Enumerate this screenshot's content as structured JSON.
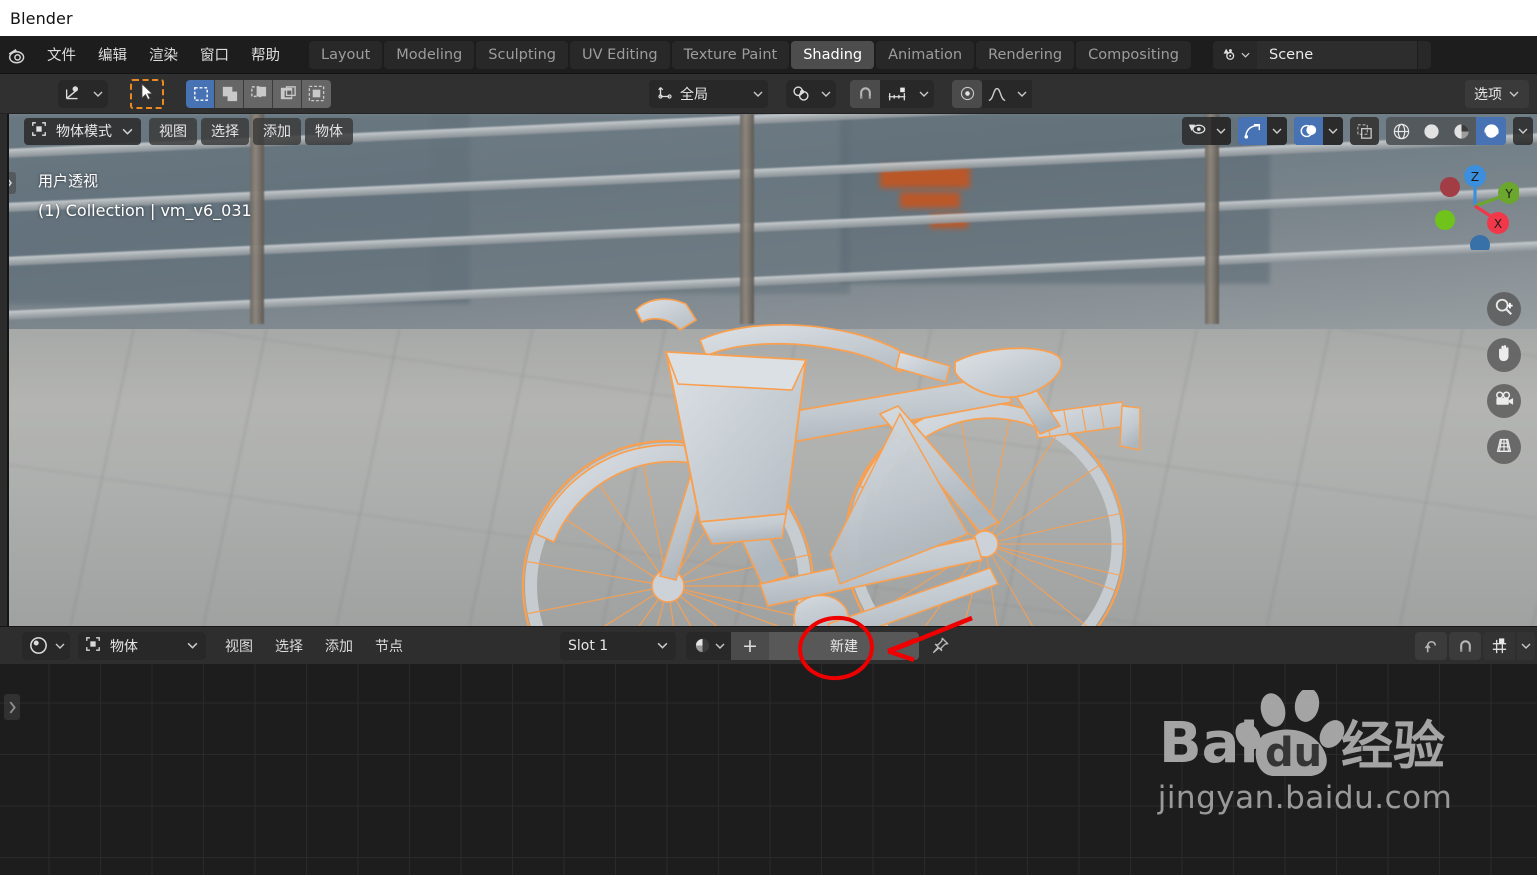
{
  "window": {
    "title": "Blender"
  },
  "topbar": {
    "logo_icon": "blender-logo-icon",
    "menus": [
      {
        "label": "文件",
        "name": "menu-file"
      },
      {
        "label": "编辑",
        "name": "menu-edit"
      },
      {
        "label": "渲染",
        "name": "menu-render"
      },
      {
        "label": "窗口",
        "name": "menu-window"
      },
      {
        "label": "帮助",
        "name": "menu-help"
      }
    ],
    "workspace_tabs": [
      {
        "label": "Layout",
        "active": false
      },
      {
        "label": "Modeling",
        "active": false
      },
      {
        "label": "Sculpting",
        "active": false
      },
      {
        "label": "UV Editing",
        "active": false
      },
      {
        "label": "Texture Paint",
        "active": false
      },
      {
        "label": "Shading",
        "active": true
      },
      {
        "label": "Animation",
        "active": false
      },
      {
        "label": "Rendering",
        "active": false
      },
      {
        "label": "Compositing",
        "active": false
      }
    ],
    "scene": {
      "icon": "scene-icon",
      "chevron_icon": "chevron-down-icon",
      "name": "Scene"
    }
  },
  "tool_settings": {
    "tool_preset_icon": "transform-orientation-icon",
    "tool_preset_chevron": "chevron-down-icon",
    "active_tool_icon": "tweak-cursor-icon",
    "select_modes": [
      {
        "name": "select-set",
        "icon": "select-set-icon",
        "active": true
      },
      {
        "name": "select-extend",
        "icon": "select-extend-icon",
        "active": false
      },
      {
        "name": "select-subtract",
        "icon": "select-subtract-icon",
        "active": false
      },
      {
        "name": "select-invert",
        "icon": "select-invert-icon",
        "active": false
      },
      {
        "name": "select-intersect",
        "icon": "select-intersect-icon",
        "active": false
      }
    ],
    "orientation": {
      "icon": "orientation-axes-icon",
      "label": "全局",
      "chevron_icon": "chevron-down-icon"
    },
    "pivot": {
      "icon": "pivot-point-icon",
      "chevron_icon": "chevron-down-icon"
    },
    "snap": {
      "magnet_icon": "magnet-icon",
      "increment_icon": "snap-increment-icon",
      "chevron_icon": "chevron-down-icon"
    },
    "proportional": {
      "icon": "proportional-edit-icon",
      "falloff_icon": "smooth-falloff-icon",
      "chevron_icon": "chevron-down-icon"
    },
    "options_label": "选项",
    "options_chevron": "chevron-down-icon"
  },
  "viewport": {
    "mode": {
      "icon": "object-mode-icon",
      "label": "物体模式",
      "chevron_icon": "chevron-down-icon"
    },
    "menus": [
      {
        "label": "视图",
        "name": "viewport-menu-view"
      },
      {
        "label": "选择",
        "name": "viewport-menu-select"
      },
      {
        "label": "添加",
        "name": "viewport-menu-add"
      },
      {
        "label": "物体",
        "name": "viewport-menu-object"
      }
    ],
    "overlay_line1": "用户透视",
    "overlay_line2": "(1) Collection | vm_v6_031",
    "header_right": {
      "visibility_icon": "object-visibility-icon",
      "visibility_chevron": "chevron-down-icon",
      "gizmo_icon": "gizmo-icon",
      "gizmo_active": true,
      "gizmo_chevron": "chevron-down-icon",
      "overlays_icon": "overlays-icon",
      "overlays_active": true,
      "overlays_chevron": "chevron-down-icon",
      "xray_icon": "xray-toggle-icon",
      "shading_modes": [
        {
          "name": "shading-wireframe",
          "icon": "wireframe-icon",
          "active": false
        },
        {
          "name": "shading-solid",
          "icon": "solid-sphere-icon",
          "active": false
        },
        {
          "name": "shading-material",
          "icon": "material-preview-icon",
          "active": false
        },
        {
          "name": "shading-rendered",
          "icon": "rendered-icon",
          "active": true
        }
      ],
      "shading_chevron": "chevron-down-icon"
    },
    "gizmo_axes": [
      {
        "label": "Z",
        "color": "#3b8fdd"
      },
      {
        "label": "Y",
        "color": "#6ba62d"
      },
      {
        "label": "X",
        "color": "#f1374a"
      }
    ],
    "gizmo_negative_colors": [
      "#a23d46",
      "#6fc31b",
      "#3870a8"
    ],
    "nav_buttons": [
      {
        "name": "zoom-nav-button",
        "icon": "magnifier-plus-icon"
      },
      {
        "name": "pan-nav-button",
        "icon": "hand-icon"
      },
      {
        "name": "camera-nav-button",
        "icon": "camera-icon"
      },
      {
        "name": "ortho-perspective-button",
        "icon": "grid-perspective-icon"
      }
    ],
    "scene_object": "bicycle-model",
    "selection_outline_color": "#f9a050",
    "left_edge_arrow": "chevron-right-icon"
  },
  "shader_editor": {
    "editor_type_icon": "shader-editor-icon",
    "editor_type_chevron": "chevron-down-icon",
    "shader_type": {
      "icon": "object-mode-icon",
      "label": "物体",
      "chevron_icon": "chevron-down-icon"
    },
    "menus": [
      {
        "label": "视图",
        "name": "shader-menu-view"
      },
      {
        "label": "选择",
        "name": "shader-menu-select"
      },
      {
        "label": "添加",
        "name": "shader-menu-add"
      },
      {
        "label": "节点",
        "name": "shader-menu-node"
      }
    ],
    "slot": {
      "label": "Slot 1",
      "chevron_icon": "chevron-down-icon"
    },
    "material": {
      "browse_icon": "material-sphere-icon",
      "browse_chevron": "chevron-down-icon",
      "new_plus_label": "+",
      "new_label": "新建",
      "pin_icon": "pin-icon"
    },
    "right_buttons": [
      {
        "name": "snap-to-node-button",
        "icon": "arrow-up-corner-icon"
      },
      {
        "name": "node-snap-magnet-button",
        "icon": "magnet-icon"
      },
      {
        "name": "node-snap-grid-button",
        "icon": "snap-grid-icon"
      },
      {
        "name": "node-snap-chevron",
        "icon": "chevron-down-icon"
      }
    ],
    "left_edge_arrow": "chevron-right-icon"
  },
  "watermark": {
    "brand_latin": "Bai",
    "brand_du": "du",
    "brand_cn": "经验",
    "url": "jingyan.baidu.com",
    "paw_icon": "baidu-paw-icon"
  },
  "annotation": {
    "circle_color": "#ee0000",
    "arrow_color": "#ee0000",
    "target_label": "新建"
  },
  "colors": {
    "accent_blue": "#4772b3",
    "selection_orange": "#f9a050",
    "annotation_red": "#ee0000",
    "header_bg": "#2e2e2e",
    "topbar_bg": "#1d1d1d",
    "toolbar_bg": "#303030"
  }
}
